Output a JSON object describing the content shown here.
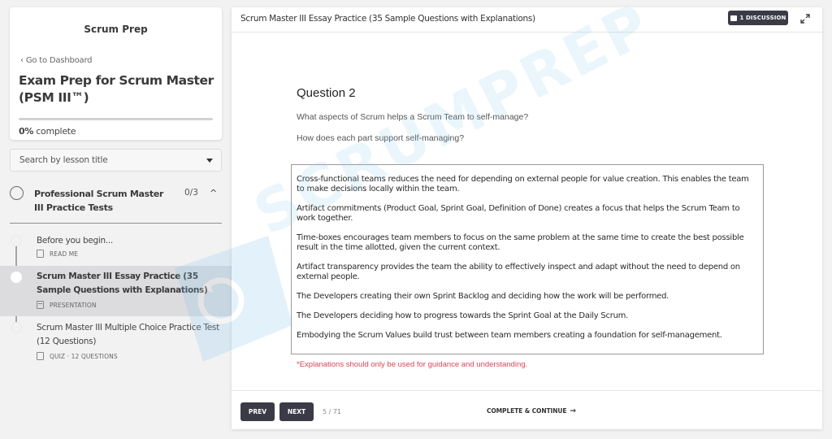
{
  "sidebar": {
    "brand": "Scrum Prep",
    "back_link": "Go to Dashboard",
    "course_title": "Exam Prep for Scrum Master (PSM III™)",
    "progress": {
      "percent_value": 0,
      "percent_label": "0%",
      "suffix": "complete"
    },
    "search": {
      "placeholder": "Search by lesson title"
    },
    "section": {
      "title": "Professional Scrum Master III Practice Tests",
      "count": "0/3",
      "expanded": true
    },
    "lessons": [
      {
        "title": "Before you begin...",
        "type": "READ ME",
        "icon": "document-icon",
        "active": false
      },
      {
        "title": "Scrum Master III Essay Practice (35 Sample Questions with Explanations)",
        "type": "PRESENTATION",
        "icon": "presentation-icon",
        "active": true
      },
      {
        "title": "Scrum Master III Multiple Choice Practice Test (12 Questions)",
        "type": "QUIZ · 12 QUESTIONS",
        "icon": "quiz-icon",
        "active": false
      }
    ]
  },
  "main": {
    "title": "Scrum Master III Essay Practice (35 Sample Questions with Explanations)",
    "discussion_label": "1 DISCUSSION",
    "question": {
      "heading": "Question 2",
      "prompt_1": "What aspects of Scrum helps a Scrum Team to self-manage?",
      "prompt_2": "How does each part support self-managing?"
    },
    "answers": [
      "Cross-functional teams reduces the need for depending on external people for value creation. This enables the team to make decisions locally within the team.",
      "Artifact commitments (Product Goal, Sprint Goal, Definition of Done) creates a focus that helps the Scrum Team to work together.",
      "Time-boxes encourages team members to focus on the same problem at the same time to create the best possible result in the time allotted, given the current context.",
      "Artifact transparency provides the team the ability to effectively inspect and adapt without the need to depend on external people.",
      "The Developers creating their own Sprint Backlog and deciding how the work will be performed.",
      "The Developers deciding how to progress towards the Sprint Goal at the Daily Scrum.",
      "Embodying the Scrum Values build trust between team members creating a foundation for self-management."
    ],
    "disclaimer": "*Explanations should only be used for guidance and understanding.",
    "watermark_text": "SCRUMPREP"
  },
  "footer": {
    "prev_label": "PREV",
    "next_label": "NEXT",
    "page_count": "5 / 71",
    "complete_label": "COMPLETE & CONTINUE",
    "complete_arrow": "→"
  },
  "colors": {
    "button_dark": "#3b3b48",
    "disclaimer_red": "#d9465a",
    "watermark_blue": "#7fc4ec",
    "background": "#f2f2f3"
  }
}
